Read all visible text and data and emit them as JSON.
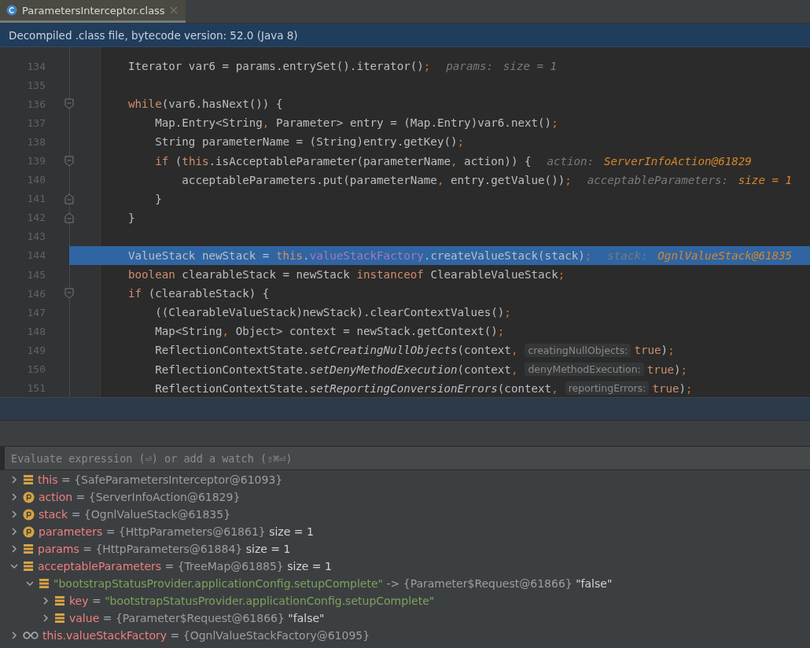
{
  "tabs": [
    {
      "label": "ParametersInterceptor.class",
      "selected": true
    }
  ],
  "banner": "Decompiled .class file, bytecode version: 52.0 (Java 8)",
  "code_lines": [
    {
      "number": "134",
      "fold_start": false,
      "fold_end": false,
      "selected": false,
      "tokens": [
        {
          "text": "Iterator var6 = params.entrySet().iterator()",
          "kind": "plain"
        },
        {
          "text": ";",
          "kind": "punct"
        },
        {
          "text": "params:",
          "kind": "hint"
        },
        {
          "text": "size = 1",
          "kind": "hint"
        }
      ]
    },
    {
      "number": "135",
      "fold_start": false,
      "fold_end": false,
      "selected": false
    },
    {
      "number": "136",
      "fold_start": true,
      "fold_end": false,
      "selected": false,
      "tokens": [
        {
          "text": "while",
          "kind": "keyword"
        },
        {
          "text": "(var6.hasNext()) {",
          "kind": "plain"
        }
      ]
    },
    {
      "number": "137",
      "fold_start": false,
      "fold_end": false,
      "selected": false,
      "tokens": [
        {
          "text": "    Map.Entry<String",
          "kind": "plain"
        },
        {
          "text": ",",
          "kind": "punct"
        },
        {
          "text": " Parameter> entry = (Map.Entry)var6.next()",
          "kind": "plain"
        },
        {
          "text": ";",
          "kind": "punct"
        }
      ]
    },
    {
      "number": "138",
      "fold_start": false,
      "fold_end": false,
      "selected": false,
      "tokens": [
        {
          "text": "    String parameterName = (String)entry.getKey()",
          "kind": "plain"
        },
        {
          "text": ";",
          "kind": "punct"
        }
      ]
    },
    {
      "number": "139",
      "fold_start": true,
      "fold_end": false,
      "selected": false,
      "tokens": [
        {
          "text": "    if",
          "kind": "keyword"
        },
        {
          "text": " (",
          "kind": "plain"
        },
        {
          "text": "this",
          "kind": "keyword"
        },
        {
          "text": ".isAcceptableParameter(parameterName",
          "kind": "plain"
        },
        {
          "text": ",",
          "kind": "punct"
        },
        {
          "text": " action)) {",
          "kind": "plain"
        },
        {
          "text": "action:",
          "kind": "hint"
        },
        {
          "text": "ServerInfoAction@61829",
          "kind": "hint_value"
        }
      ]
    },
    {
      "number": "140",
      "fold_start": false,
      "fold_end": false,
      "selected": false,
      "tokens": [
        {
          "text": "        acceptableParameters.put(parameterName",
          "kind": "plain"
        },
        {
          "text": ",",
          "kind": "punct"
        },
        {
          "text": " entry.getValue())",
          "kind": "plain"
        },
        {
          "text": ";",
          "kind": "punct"
        },
        {
          "text": "acceptableParameters:",
          "kind": "hint"
        },
        {
          "text": "size = 1",
          "kind": "hint_value"
        }
      ]
    },
    {
      "number": "141",
      "fold_start": false,
      "fold_end": true,
      "selected": false,
      "tokens": [
        {
          "text": "    }",
          "kind": "plain"
        }
      ]
    },
    {
      "number": "142",
      "fold_start": false,
      "fold_end": true,
      "selected": false,
      "tokens": [
        {
          "text": "}",
          "kind": "plain"
        }
      ]
    },
    {
      "number": "143",
      "fold_start": false,
      "fold_end": false,
      "selected": false
    },
    {
      "number": "144",
      "fold_start": false,
      "fold_end": false,
      "selected": true,
      "tokens": [
        {
          "text": "ValueStack newStack = ",
          "kind": "plain"
        },
        {
          "text": "this",
          "kind": "keyword"
        },
        {
          "text": ".",
          "kind": "plain"
        },
        {
          "text": "valueStackFactory",
          "kind": "field"
        },
        {
          "text": ".createValueStack(stack)",
          "kind": "plain"
        },
        {
          "text": ";",
          "kind": "punct"
        },
        {
          "text": "stack:",
          "kind": "hint"
        },
        {
          "text": "OgnlValueStack@61835",
          "kind": "hint_value"
        }
      ]
    },
    {
      "number": "145",
      "fold_start": false,
      "fold_end": false,
      "selected": false,
      "tokens": [
        {
          "text": "boolean",
          "kind": "keyword"
        },
        {
          "text": " clearableStack = newStack ",
          "kind": "plain"
        },
        {
          "text": "instanceof",
          "kind": "keyword"
        },
        {
          "text": " ClearableValueStack",
          "kind": "plain"
        },
        {
          "text": ";",
          "kind": "punct"
        }
      ]
    },
    {
      "number": "146",
      "fold_start": true,
      "fold_end": false,
      "selected": false,
      "tokens": [
        {
          "text": "if",
          "kind": "keyword"
        },
        {
          "text": " (clearableStack) {",
          "kind": "plain"
        }
      ]
    },
    {
      "number": "147",
      "fold_start": false,
      "fold_end": false,
      "selected": false,
      "tokens": [
        {
          "text": "    ((ClearableValueStack)newStack).clearContextValues()",
          "kind": "plain"
        },
        {
          "text": ";",
          "kind": "punct"
        }
      ]
    },
    {
      "number": "148",
      "fold_start": false,
      "fold_end": false,
      "selected": false,
      "tokens": [
        {
          "text": "    Map<String",
          "kind": "plain"
        },
        {
          "text": ",",
          "kind": "punct"
        },
        {
          "text": " Object> context = newStack.getContext()",
          "kind": "plain"
        },
        {
          "text": ";",
          "kind": "punct"
        }
      ]
    },
    {
      "number": "149",
      "fold_start": false,
      "fold_end": false,
      "selected": false,
      "tokens": [
        {
          "text": "    ReflectionContextState.",
          "kind": "plain"
        },
        {
          "text": "setCreatingNullObjects",
          "kind": "static"
        },
        {
          "text": "(context",
          "kind": "plain"
        },
        {
          "text": ",",
          "kind": "punct"
        },
        {
          "text": "creatingNullObjects:",
          "kind": "inlay"
        },
        {
          "text": "true",
          "kind": "keyword"
        },
        {
          "text": ")",
          "kind": "plain"
        },
        {
          "text": ";",
          "kind": "punct"
        }
      ]
    },
    {
      "number": "150",
      "fold_start": false,
      "fold_end": false,
      "selected": false,
      "tokens": [
        {
          "text": "    ReflectionContextState.",
          "kind": "plain"
        },
        {
          "text": "setDenyMethodExecution",
          "kind": "static"
        },
        {
          "text": "(context",
          "kind": "plain"
        },
        {
          "text": ",",
          "kind": "punct"
        },
        {
          "text": "denyMethodExecution:",
          "kind": "inlay"
        },
        {
          "text": "true",
          "kind": "keyword"
        },
        {
          "text": ")",
          "kind": "plain"
        },
        {
          "text": ";",
          "kind": "punct"
        }
      ]
    },
    {
      "number": "151",
      "fold_start": false,
      "fold_end": false,
      "selected": false,
      "tokens": [
        {
          "text": "    ReflectionContextState.",
          "kind": "plain"
        },
        {
          "text": "setReportingConversionErrors",
          "kind": "static"
        },
        {
          "text": "(context",
          "kind": "plain"
        },
        {
          "text": ",",
          "kind": "punct"
        },
        {
          "text": "reportingErrors:",
          "kind": "inlay"
        },
        {
          "text": "true",
          "kind": "keyword"
        },
        {
          "text": ")",
          "kind": "plain"
        },
        {
          "text": ";",
          "kind": "punct"
        }
      ]
    }
  ],
  "evaluate": {
    "placeholder": "Evaluate expression (⏎) or add a watch (⇧⌘⏎)"
  },
  "variables": [
    {
      "kind": "field",
      "expanded": false,
      "segments": [
        {
          "text": "this",
          "kind": "name"
        },
        {
          "text": "=",
          "kind": "op"
        },
        {
          "text": "{SafeParametersInterceptor@61093}",
          "kind": "value"
        }
      ]
    },
    {
      "kind": "param",
      "expanded": false,
      "segments": [
        {
          "text": "action",
          "kind": "name"
        },
        {
          "text": "=",
          "kind": "op"
        },
        {
          "text": "{ServerInfoAction@61829}",
          "kind": "value"
        }
      ]
    },
    {
      "kind": "param",
      "expanded": false,
      "segments": [
        {
          "text": "stack",
          "kind": "name"
        },
        {
          "text": "=",
          "kind": "op"
        },
        {
          "text": "{OgnlValueStack@61835}",
          "kind": "value"
        }
      ]
    },
    {
      "kind": "param",
      "expanded": false,
      "segments": [
        {
          "text": "parameters",
          "kind": "name"
        },
        {
          "text": "=",
          "kind": "op"
        },
        {
          "text": "{HttpParameters@61861}",
          "kind": "value"
        },
        {
          "text": "size = 1",
          "kind": "extra"
        }
      ]
    },
    {
      "kind": "field",
      "expanded": false,
      "segments": [
        {
          "text": "params",
          "kind": "name"
        },
        {
          "text": "=",
          "kind": "op"
        },
        {
          "text": "{HttpParameters@61884}",
          "kind": "value"
        },
        {
          "text": "size = 1",
          "kind": "extra"
        }
      ]
    },
    {
      "kind": "field",
      "expanded": true,
      "segments": [
        {
          "text": "acceptableParameters",
          "kind": "name"
        },
        {
          "text": "=",
          "kind": "op"
        },
        {
          "text": "{TreeMap@61885}",
          "kind": "value"
        },
        {
          "text": "size = 1",
          "kind": "extra"
        }
      ],
      "children": [
        {
          "kind": "field",
          "expanded": true,
          "segments": [
            {
              "text": "\"bootstrapStatusProvider.applicationConfig.setupComplete\"",
              "kind": "string"
            },
            {
              "text": "->",
              "kind": "op"
            },
            {
              "text": "{Parameter$Request@61866}",
              "kind": "value"
            },
            {
              "text": "\"false\"",
              "kind": "extra"
            }
          ],
          "children": [
            {
              "kind": "field",
              "expanded": false,
              "segments": [
                {
                  "text": "key",
                  "kind": "name"
                },
                {
                  "text": "=",
                  "kind": "op"
                },
                {
                  "text": "\"bootstrapStatusProvider.applicationConfig.setupComplete\"",
                  "kind": "string"
                }
              ]
            },
            {
              "kind": "field",
              "expanded": false,
              "segments": [
                {
                  "text": "value",
                  "kind": "name"
                },
                {
                  "text": "=",
                  "kind": "op"
                },
                {
                  "text": "{Parameter$Request@61866}",
                  "kind": "value"
                },
                {
                  "text": "\"false\"",
                  "kind": "extra"
                }
              ]
            }
          ]
        }
      ]
    },
    {
      "kind": "watch",
      "expanded": false,
      "segments": [
        {
          "text": "this.valueStackFactory",
          "kind": "name"
        },
        {
          "text": "=",
          "kind": "op"
        },
        {
          "text": "{OgnlValueStackFactory@61095}",
          "kind": "value"
        }
      ]
    }
  ]
}
